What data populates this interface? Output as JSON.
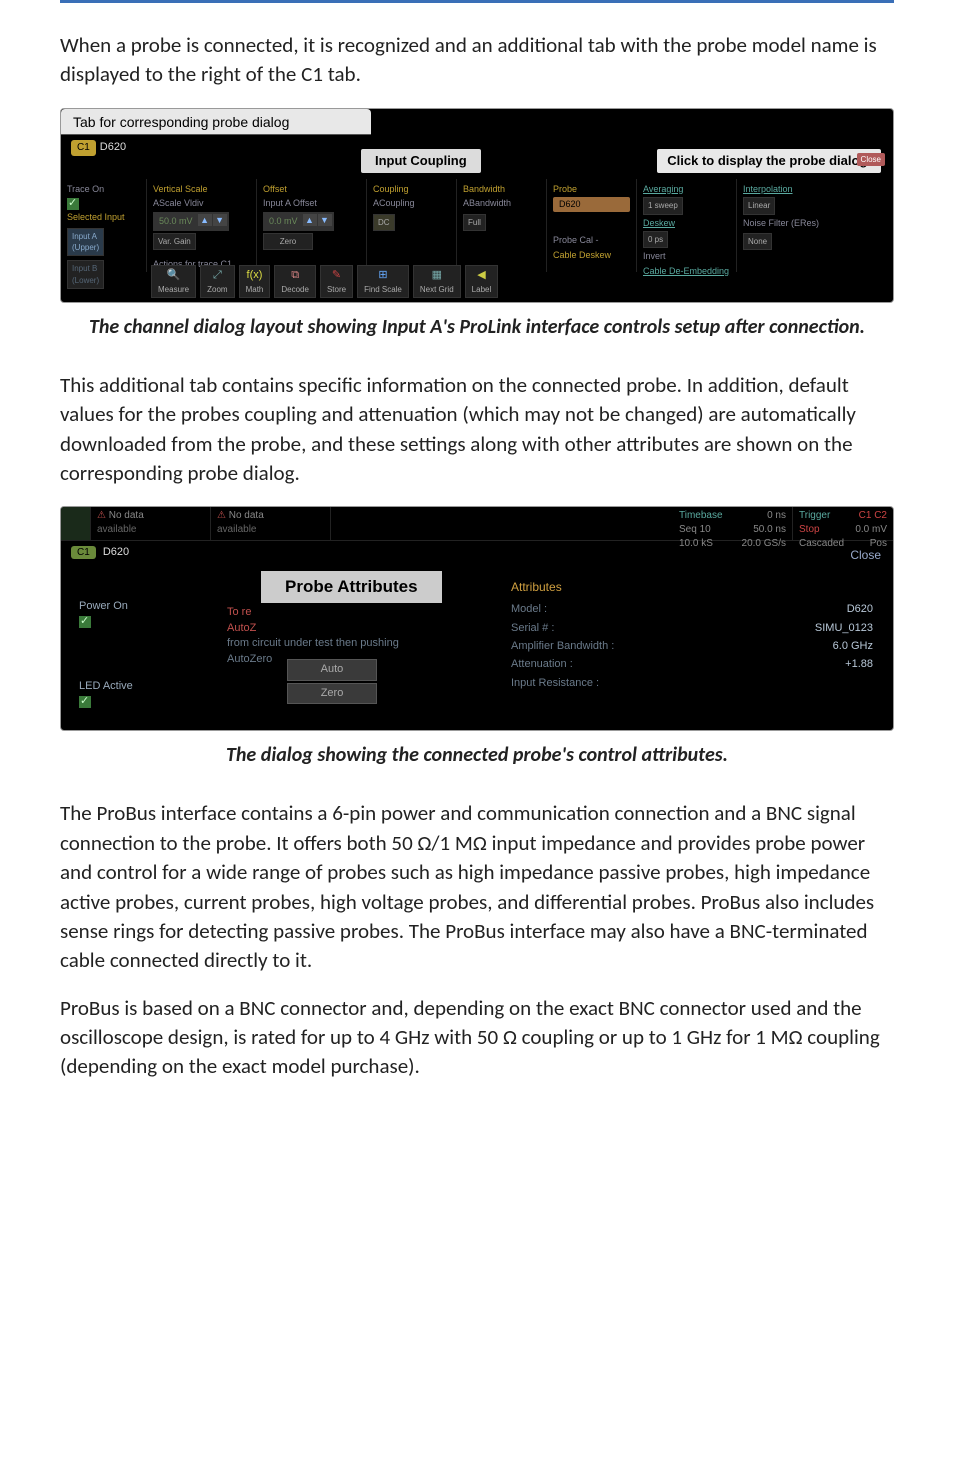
{
  "intro": "When a probe is connected, it is recognized and an additional tab with the probe model name is displayed to the right of the C1 tab.",
  "fig1": {
    "annot_left": "Tab for corresponding probe dialog",
    "tab_c1": "C1",
    "tab_d620": "D620",
    "center_title": "Input Coupling",
    "annot_right": "Click to display the probe dialog.",
    "close": "Close",
    "left": {
      "trace_on": "Trace On",
      "selected_input": "Selected Input",
      "input_a": "Input A",
      "input_a_sub": "(Upper)",
      "input_b": "Input B",
      "input_b_sub": "(Lower)"
    },
    "vertical": {
      "header": "Vertical Scale",
      "ascale": "AScale Vldiv",
      "ascale_val": "50.0 mV",
      "gain": "Var. Gain",
      "actions_hdr": "Actions for trace C1"
    },
    "offset": {
      "header": "Offset",
      "ioffset": "Input A Offset",
      "ioffset_val": "0.0 mV",
      "zero": "Zero"
    },
    "coupling": {
      "header": "Coupling",
      "acoupling": "ACoupling",
      "acoupling_val": "DC"
    },
    "bandwidth": {
      "header": "Bandwidth",
      "abandwidth": "ABandwidth",
      "abandwidth_val": "Full"
    },
    "probe": {
      "header": "Probe",
      "probe_val": "D620",
      "probe_cal": "Probe Cal -",
      "cable_deskew": "Cable Deskew"
    },
    "preproc": {
      "averaging": "Averaging",
      "sweep": "1 sweep",
      "deskew": "Deskew",
      "deskew_val": "0 ps",
      "invert": "Invert",
      "cable_de": "Cable De-Embedding"
    },
    "interp": {
      "header": "Interpolation",
      "linear": "Linear",
      "nf": "Noise Filter (ERes)",
      "none": "None"
    },
    "actions": {
      "measure": "Measure",
      "zoom": "Zoom",
      "math": "Math",
      "fx": "f(x)",
      "decode": "Decode",
      "store": "Store",
      "find_scale": "Find Scale",
      "next_grid": "Next Grid",
      "label": "Label"
    }
  },
  "caption1": "The channel dialog layout showing Input A's ProLink interface controls setup after connection.",
  "para2": "This additional tab contains specific information on the connected probe. In addition, default values for the probes coupling and attenuation (which may not be changed) are automatically downloaded from the probe, and these settings along with other attributes are shown on the corresponding probe dialog.",
  "fig2": {
    "nodata": "No data",
    "available": "available",
    "timebase": "Timebase",
    "tns": "0 ns",
    "seq": "Seq 10",
    "seq2": "50.0 ns",
    "ks": "10.0 kS",
    "gs": "20.0 GS/s",
    "trigger": "Trigger",
    "c1c2": "C1 C2",
    "stop": "Stop",
    "mv": "0.0 mV",
    "cascaded": "Cascaded",
    "pos": "Pos",
    "close": "Close",
    "tab_c1": "C1",
    "tab_d620": "D620",
    "power_on": "Power On",
    "led_active": "LED Active",
    "pa_title": "Probe Attributes",
    "hint_l1": "To re",
    "hint_l2": "AutoZ",
    "hint_l3": "from circuit under test then pushing",
    "hint_l4": "AutoZero",
    "auto_btn": "Auto",
    "zero_btn": "Zero",
    "attr_hdr": "Attributes",
    "attrs": [
      {
        "k": "Model :",
        "v": "D620"
      },
      {
        "k": "Serial # :",
        "v": "SIMU_0123"
      },
      {
        "k": "Amplifier Bandwidth :",
        "v": "6.0 GHz"
      },
      {
        "k": "Attenuation :",
        "v": "+1.88"
      },
      {
        "k": "Input Resistance :",
        "v": ""
      }
    ]
  },
  "caption2": "The dialog showing the connected probe's control attributes.",
  "para3": "The ProBus interface contains a 6-pin power and communication connection and a BNC signal connection to the probe. It offers both 50 Ω/1 MΩ input impedance and provides probe power and control for a wide range of probes such as high impedance passive probes, high impedance active probes, current probes, high voltage probes, and differential probes. ProBus also includes sense rings for detecting passive probes. The ProBus interface may also have a BNC-terminated cable connected directly to it.",
  "para4": "ProBus is based on a BNC connector and, depending on the exact BNC connector used and the oscilloscope design, is rated for up to 4 GHz with 50 Ω coupling or up to 1 GHz for 1 MΩ coupling (depending on the exact model purchase)."
}
